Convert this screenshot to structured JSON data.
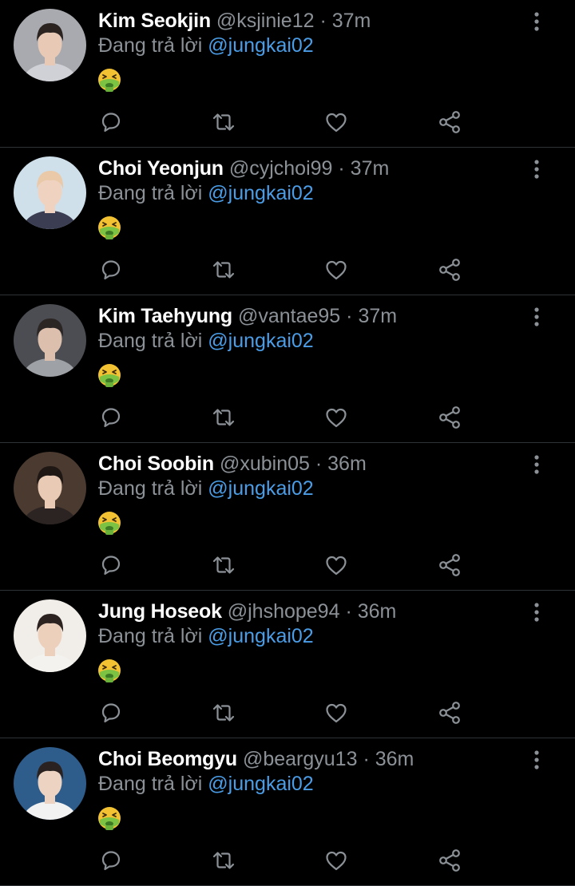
{
  "colors": {
    "background": "#000000",
    "name": "#ffffff",
    "secondary_text": "#8b9196",
    "mention": "#4a9de6",
    "divider": "#2f3336",
    "icon": "#8b9196"
  },
  "icons": {
    "reply": "reply-icon",
    "retweet": "retweet-icon",
    "like": "heart-icon",
    "share": "share-icon",
    "more": "more-options-icon",
    "reaction": "nauseated-face-emoji"
  },
  "tweets": [
    {
      "name": "Kim Seokjin",
      "handle": "@ksjinie12",
      "separator": "·",
      "time": "37m",
      "reply_prefix": "Đang trả lời",
      "reply_to": "@jungkai02",
      "content": "🤮",
      "avatar": {
        "bg": "#a8aab0",
        "skin": "#e8c9b6",
        "hair": "#2a2320",
        "shirt": "#cfd1d6"
      }
    },
    {
      "name": "Choi Yeonjun",
      "handle": "@cyjchoi99",
      "separator": "·",
      "time": "37m",
      "reply_prefix": "Đang trả lời",
      "reply_to": "@jungkai02",
      "content": "🤮",
      "avatar": {
        "bg": "#cfe0ea",
        "skin": "#efd3c0",
        "hair": "#e9c9a8",
        "shirt": "#3b3e52"
      }
    },
    {
      "name": "Kim Taehyung",
      "handle": "@vantae95",
      "separator": "·",
      "time": "37m",
      "reply_prefix": "Đang trả lời",
      "reply_to": "@jungkai02",
      "content": "🤮",
      "avatar": {
        "bg": "#4b4d52",
        "skin": "#dcc0ad",
        "hair": "#2b2624",
        "shirt": "#9ea1a6"
      }
    },
    {
      "name": "Choi Soobin",
      "handle": "@xubin05",
      "separator": "·",
      "time": "36m",
      "reply_prefix": "Đang trả lời",
      "reply_to": "@jungkai02",
      "content": "🤮",
      "avatar": {
        "bg": "#4b3a30",
        "skin": "#e9cbb5",
        "hair": "#1e1714",
        "shirt": "#2b2422"
      }
    },
    {
      "name": "Jung Hoseok",
      "handle": "@jhshope94",
      "separator": "·",
      "time": "36m",
      "reply_prefix": "Đang trả lời",
      "reply_to": "@jungkai02",
      "content": "🤮",
      "avatar": {
        "bg": "#f1ede8",
        "skin": "#ecd0bc",
        "hair": "#2c2320",
        "shirt": "#f4f2ee"
      }
    },
    {
      "name": "Choi Beomgyu",
      "handle": "@beargyu13",
      "separator": "·",
      "time": "36m",
      "reply_prefix": "Đang trả lời",
      "reply_to": "@jungkai02",
      "content": "🤮",
      "avatar": {
        "bg": "#2e5d8c",
        "skin": "#ecd3c2",
        "hair": "#2a2220",
        "shirt": "#f2f2f2"
      }
    }
  ]
}
